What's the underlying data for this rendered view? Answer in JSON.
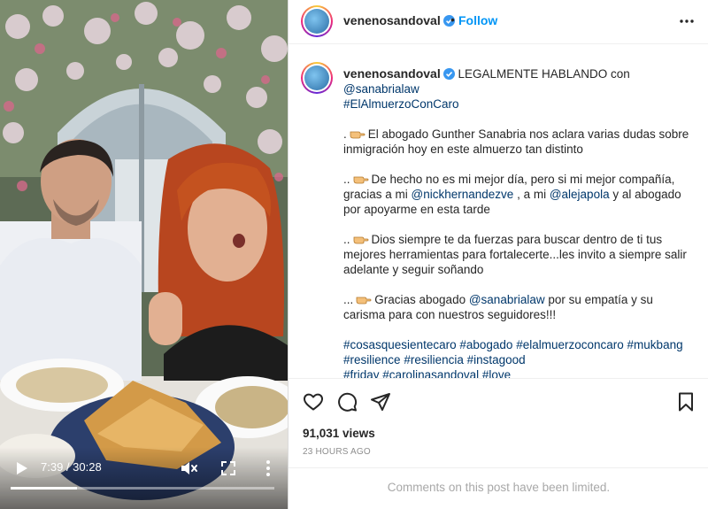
{
  "video": {
    "current_time": "7:39",
    "duration": "30:28",
    "progress_fraction": 0.251,
    "muted": true
  },
  "header": {
    "username": "venenosandoval",
    "dot": "•",
    "follow_label": "Follow"
  },
  "caption": {
    "username": "venenosandoval",
    "line1_text": " LEGALMENTE HABLANDO con ",
    "line1_mention": "@sanabrialaw",
    "line1_tag": "#ElAlmuerzoConCaro",
    "p1_prefix": ".",
    "p1_text": "El abogado Gunther Sanabria nos aclara varias dudas sobre inmigración hoy en este almuerzo tan distinto",
    "p2_prefix": "..",
    "p2_text_a": "De hecho no es mi mejor día, pero si mi mejor compañía, gracias a mi ",
    "p2_mention_a": "@nickhernandezve",
    "p2_text_b": " , a mi ",
    "p2_mention_b": "@alejapola",
    "p2_text_c": " y al abogado por apoyarme en esta tarde",
    "p3_prefix": "..",
    "p3_text": "Dios siempre te da fuerzas para buscar dentro de ti tus mejores herramientas para fortalecerte...les invito a siempre salir adelante y seguir soñando",
    "p4_prefix": "...",
    "p4_text_a": "Gracias abogado ",
    "p4_mention": "@sanabrialaw",
    "p4_text_b": " por su empatía y su carisma para con nuestros seguidores!!!",
    "hashtags_line1": [
      "#cosasquesientecaro",
      "#abogado",
      "#elalmuerzoconcaro",
      "#mukbang"
    ],
    "hashtags_line2": [
      "#resilience",
      "#resiliencia",
      "#instagood"
    ],
    "hashtags_line3": [
      "#friday",
      "#carolinasandoval",
      "#love"
    ]
  },
  "stats": {
    "views": "91,031 views",
    "posted_ago": "23 HOURS AGO"
  },
  "comments_notice": "Comments on this post have been limited.",
  "icons": {
    "like": "heart-icon",
    "comment": "comment-bubble-icon",
    "share": "paper-plane-icon",
    "save": "bookmark-icon",
    "verified": "verified-badge-icon",
    "emoji": "pointing-hand-emoji"
  },
  "colors": {
    "link_blue": "#0095f6",
    "mention_navy": "#00376b",
    "verified_blue": "#3897f0",
    "muted_gray": "#8e8e8e"
  }
}
